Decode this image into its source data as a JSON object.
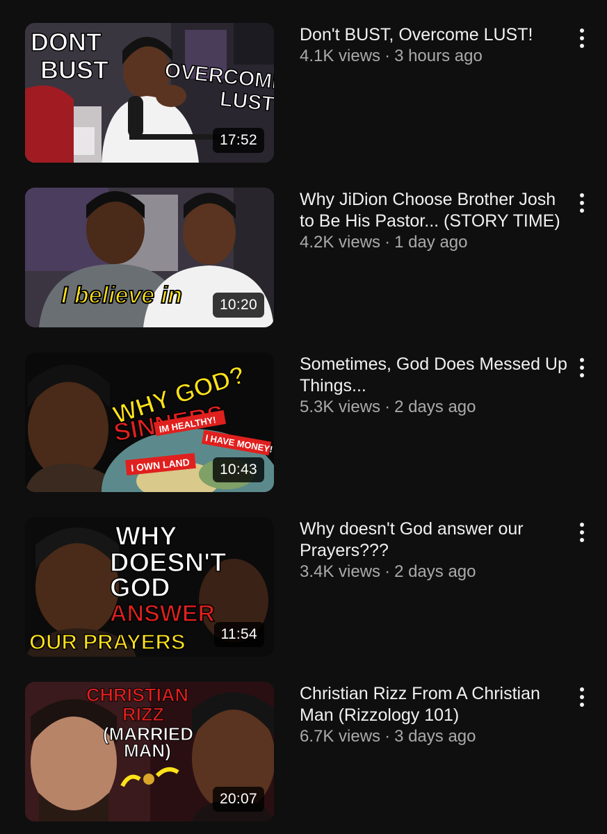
{
  "videos": [
    {
      "title": "Don't BUST, Overcome LUST!",
      "views": "4.1K views",
      "age": "3 hours ago",
      "duration": "17:52",
      "thumb_text": [
        "DONT",
        "BUST",
        "OVERCOME",
        "LUST"
      ]
    },
    {
      "title": "Why JiDion Choose Brother Josh to Be His Pastor... (STORY TIME)",
      "views": "4.2K views",
      "age": "1 day ago",
      "duration": "10:20",
      "thumb_text": [
        "I believe in"
      ]
    },
    {
      "title": "Sometimes, God Does Messed Up Things...",
      "views": "5.3K views",
      "age": "2 days ago",
      "duration": "10:43",
      "thumb_text": [
        "WHY GOD?",
        "SINNERS",
        "IM HEALTHY!",
        "I HAVE MONEY!",
        "I OWN LAND"
      ]
    },
    {
      "title": "Why doesn't God answer our Prayers???",
      "views": "3.4K views",
      "age": "2 days ago",
      "duration": "11:54",
      "thumb_text": [
        "WHY",
        "DOESN'T",
        "GOD",
        "ANSWER",
        "OUR PRAYERS"
      ]
    },
    {
      "title": "Christian Rizz From A Christian Man (Rizzology 101)",
      "views": "6.7K views",
      "age": "3 days ago",
      "duration": "20:07",
      "thumb_text": [
        "CHRISTIAN",
        "RIZZ",
        "(MARRIED",
        "MAN)"
      ]
    }
  ],
  "separator": "·",
  "more_icon": "more-vertical-icon",
  "colors": {
    "background": "#0f0f0f",
    "title": "#f1f1f1",
    "subtitle": "#aaaaaa",
    "thumb_red": "#e0201e",
    "thumb_yellow": "#ffe21a"
  }
}
